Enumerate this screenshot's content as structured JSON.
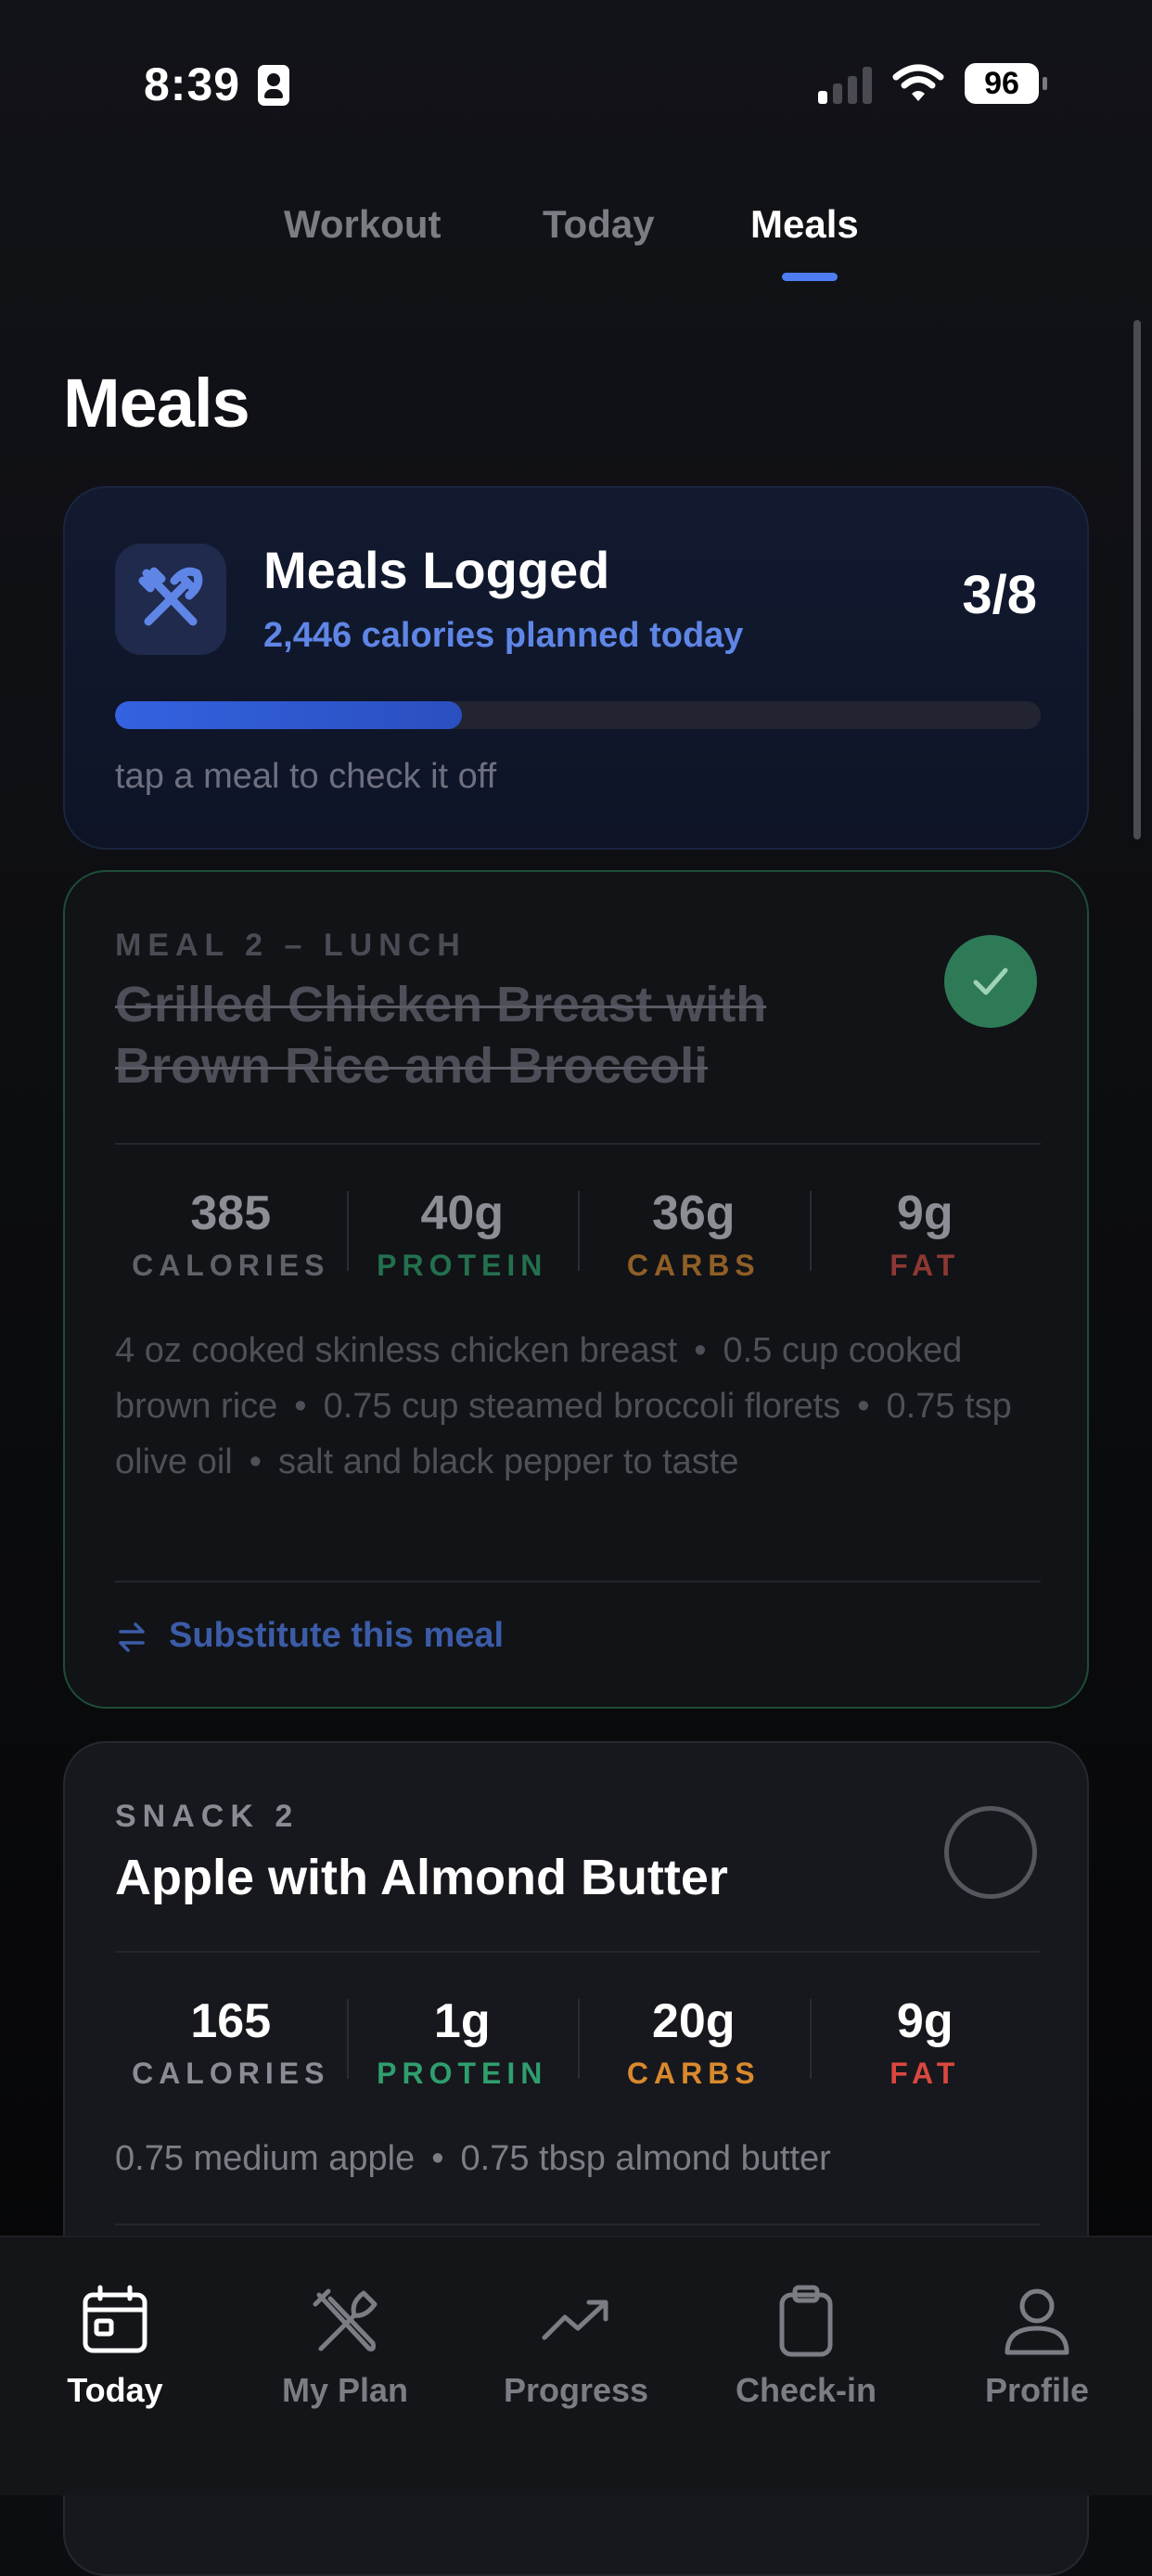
{
  "status_bar": {
    "time": "8:39",
    "battery": "96"
  },
  "top_tabs": [
    {
      "label": "Workout"
    },
    {
      "label": "Today"
    },
    {
      "label": "Meals",
      "active": true
    }
  ],
  "page_title": "Meals",
  "summary": {
    "title": "Meals Logged",
    "subtitle": "2,446 calories planned today",
    "count": "3/8",
    "progress": 0.375,
    "hint": "tap a meal to check it off"
  },
  "meals": [
    {
      "label": "MEAL 2 – LUNCH",
      "name": "Grilled Chicken Breast with Brown Rice and Broccoli",
      "done": true,
      "macros": {
        "calories": "385",
        "calories_label": "CALORIES",
        "protein": "40g",
        "protein_label": "PROTEIN",
        "carbs": "36g",
        "carbs_label": "CARBS",
        "fat": "9g",
        "fat_label": "FAT"
      },
      "ingredients": [
        "4 oz cooked skinless chicken breast",
        "0.5 cup cooked brown rice",
        "0.75 cup steamed broccoli florets",
        "0.75 tsp olive oil",
        "salt and black pepper to taste"
      ],
      "substitute_label": "Substitute this meal"
    },
    {
      "label": "SNACK 2",
      "name": "Apple with Almond Butter",
      "done": false,
      "macros": {
        "calories": "165",
        "calories_label": "CALORIES",
        "protein": "1g",
        "protein_label": "PROTEIN",
        "carbs": "20g",
        "carbs_label": "CARBS",
        "fat": "9g",
        "fat_label": "FAT"
      },
      "ingredients": [
        "0.75 medium apple",
        "0.75 tbsp almond butter"
      ]
    }
  ],
  "ingredient_separator": "•",
  "bottom_nav": [
    {
      "label": "Today",
      "icon": "calendar-icon",
      "active": true
    },
    {
      "label": "My Plan",
      "icon": "fork-knife-icon"
    },
    {
      "label": "Progress",
      "icon": "trend-up-icon"
    },
    {
      "label": "Check-in",
      "icon": "clipboard-icon"
    },
    {
      "label": "Profile",
      "icon": "person-icon"
    }
  ],
  "colors": {
    "accent": "#4d7df0",
    "done_green": "#2e7a57",
    "protein": "#2f9e6e",
    "carbs": "#d9892d",
    "fat": "#d9483f"
  }
}
